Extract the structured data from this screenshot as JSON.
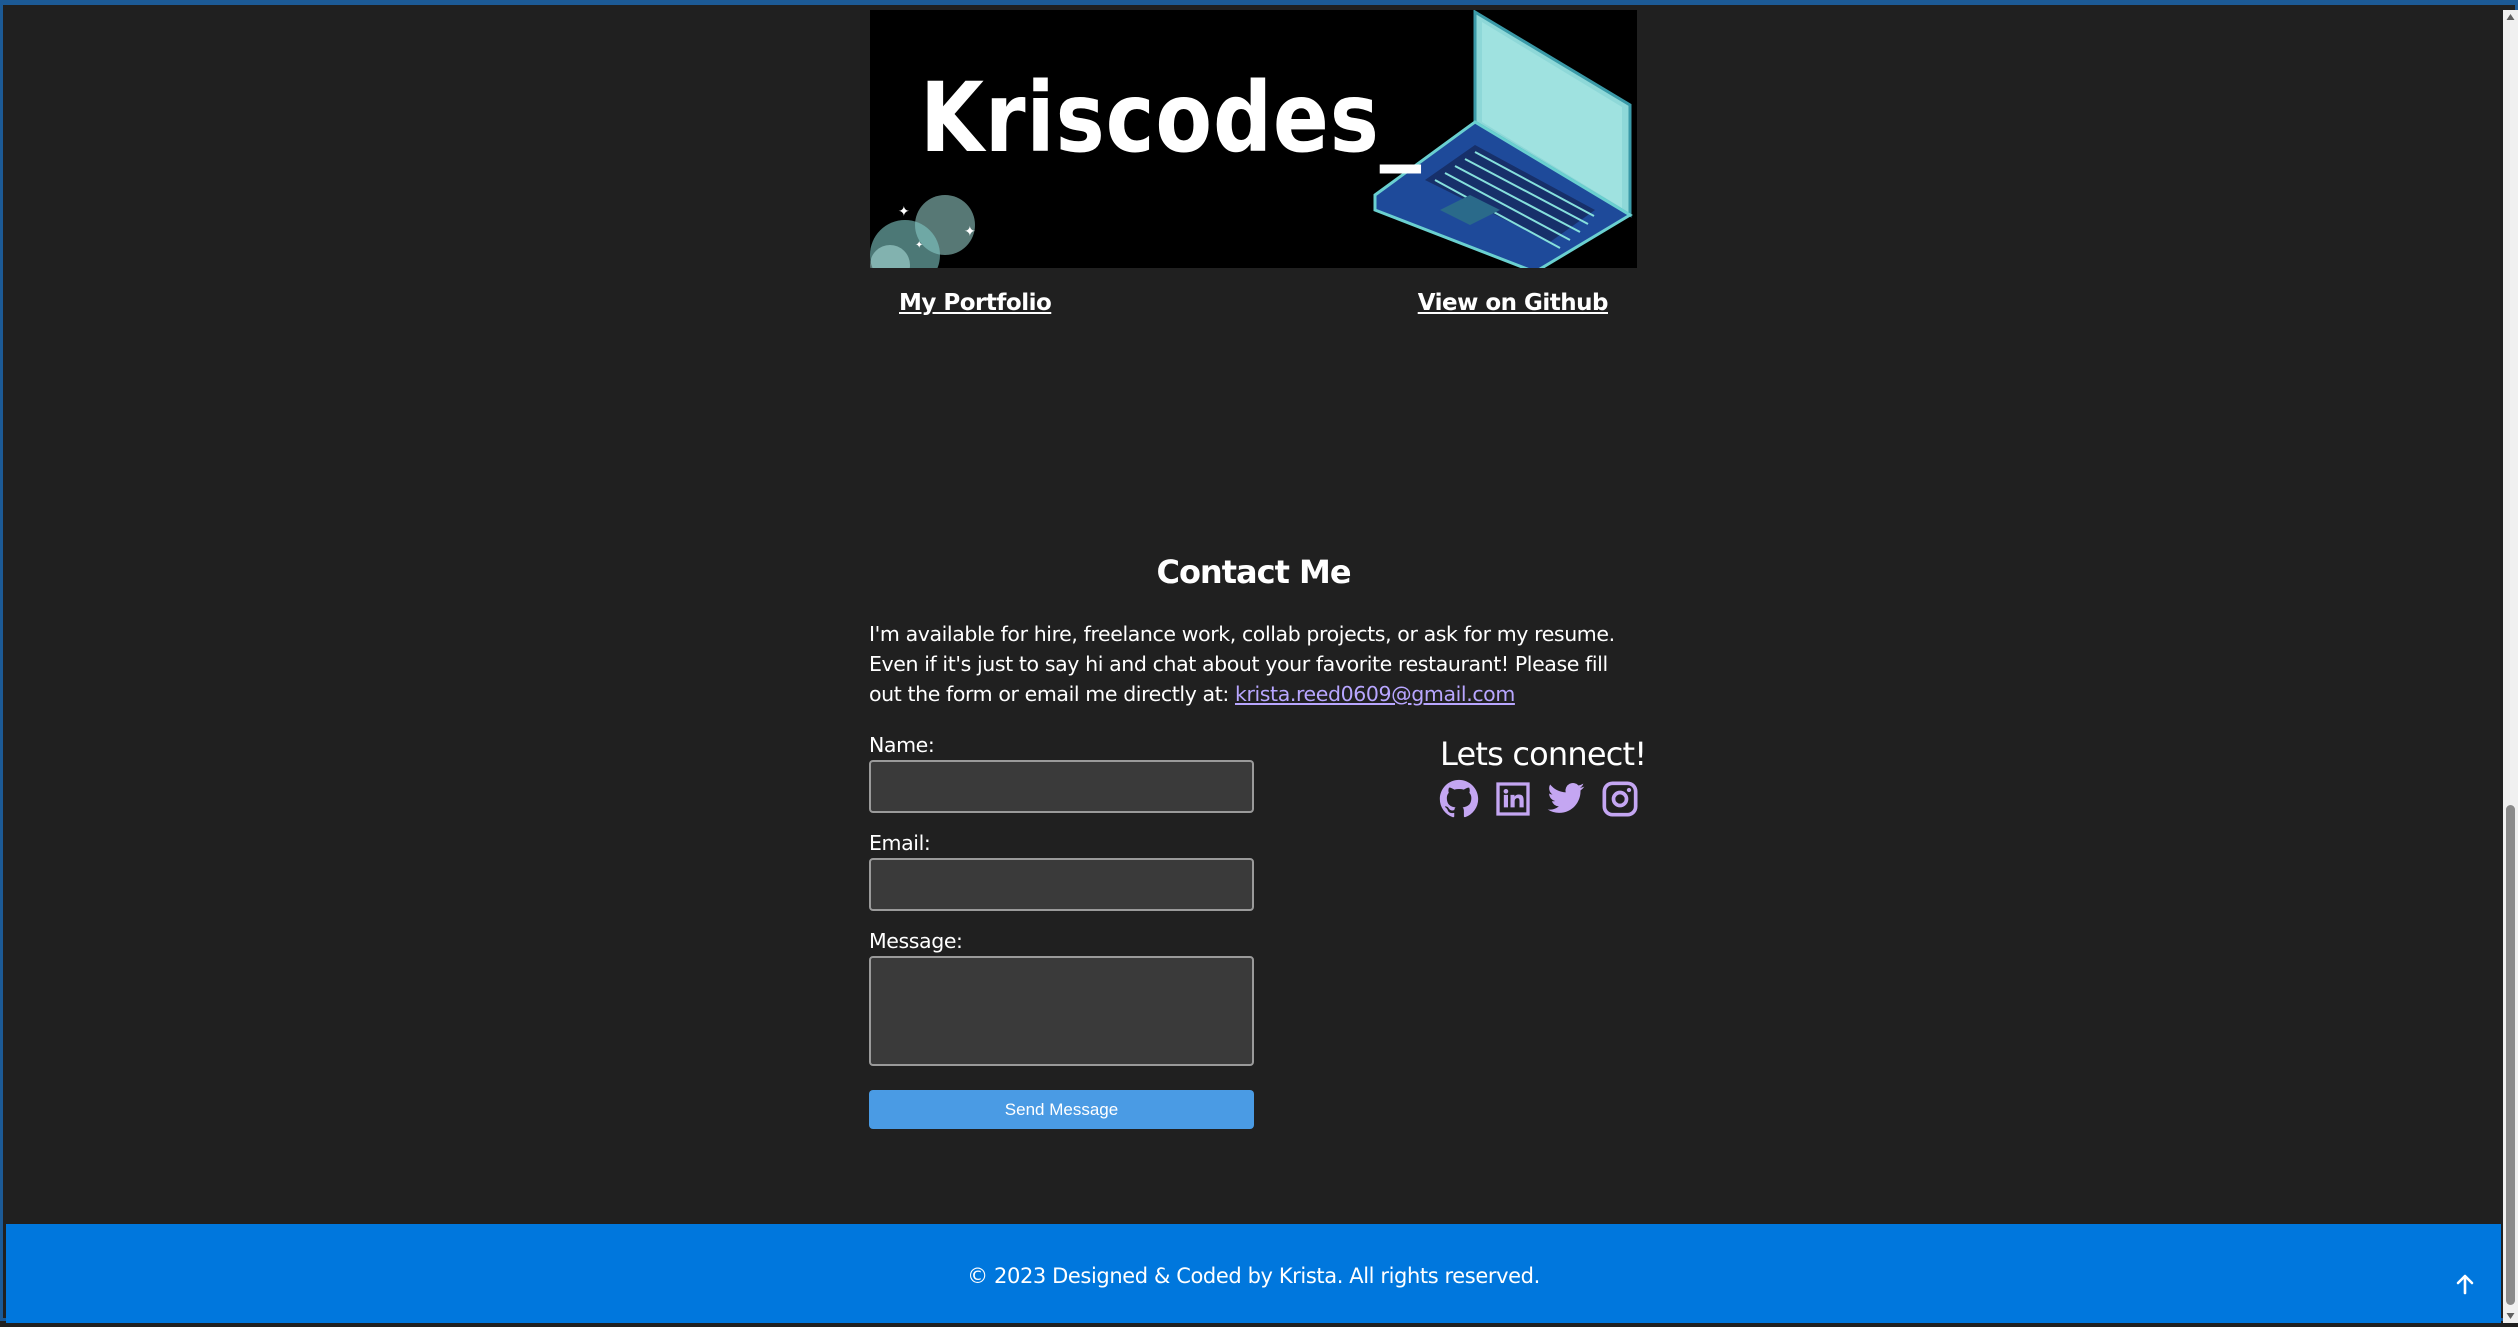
{
  "project": {
    "banner_title": "Kriscodes_",
    "portfolio_link": "My Portfolio",
    "github_link": "View on Github"
  },
  "contact": {
    "title": "Contact Me",
    "intro_text": "I'm available for hire, freelance work, collab projects, or ask for my resume. Even if it's just to say hi and chat about your favorite restaurant! Please fill out the form or email me directly at: ",
    "email": "krista.reed0609@gmail.com",
    "form": {
      "name_label": "Name:",
      "name_value": "",
      "email_label": "Email:",
      "email_value": "",
      "message_label": "Message:",
      "message_value": "",
      "submit_label": "Send Message"
    },
    "connect_title": "Lets connect!",
    "socials": [
      {
        "icon": "github-icon"
      },
      {
        "icon": "linkedin-icon"
      },
      {
        "icon": "twitter-icon"
      },
      {
        "icon": "instagram-icon"
      }
    ]
  },
  "footer": {
    "text": "© 2023 Designed & Coded by Krista. All rights reserved.",
    "to_top_icon": "arrow-up-icon"
  },
  "colors": {
    "background": "#202020",
    "footer": "#0077dd",
    "button": "#4a9be4",
    "social_icons": "#c4a6f2",
    "link": "#b8a6ff"
  }
}
